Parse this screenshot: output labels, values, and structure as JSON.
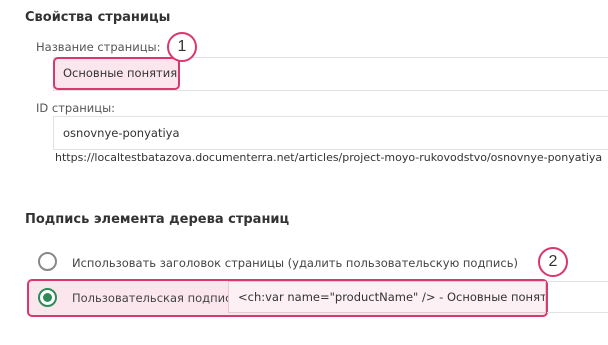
{
  "page_properties": {
    "section_title": "Свойства страницы",
    "page_name_label": "Название страницы:",
    "page_name_value": "Основные понятия",
    "page_id_label": "ID страницы:",
    "page_id_value": "osnovnye-ponyatiya",
    "page_url": "https://localtestbatazova.documenterra.net/articles/project-moyo-rukovodstvo/osnovnye-ponyatiya"
  },
  "tree_caption": {
    "section_title": "Подпись элемента дерева страниц",
    "use_title_option": "Использовать заголовок страницы (удалить пользовательскую подпись)",
    "custom_option": "Пользовательская подпись",
    "custom_value": "<ch:var name=\"productName\" /> - Основные понятия",
    "selected": "custom"
  },
  "callouts": {
    "first": "1",
    "second": "2"
  },
  "colors": {
    "highlight_border": "#d8386d",
    "highlight_fill": "#fce6ee",
    "radio_checked": "#2e8b57"
  }
}
